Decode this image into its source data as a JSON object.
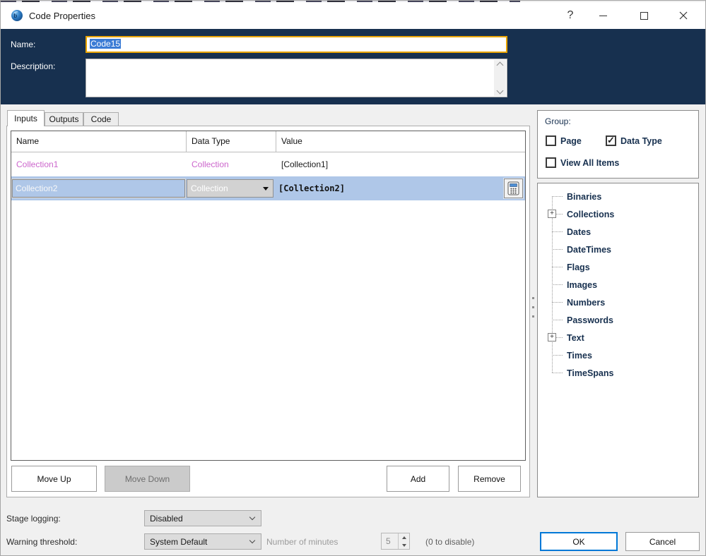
{
  "window": {
    "title": "Code Properties",
    "help_label": "?"
  },
  "header": {
    "name_label": "Name:",
    "name_value": "Code15",
    "description_label": "Description:",
    "description_value": ""
  },
  "tabs": [
    {
      "label": "Inputs",
      "active": true
    },
    {
      "label": "Outputs",
      "active": false
    },
    {
      "label": "Code",
      "active": false
    }
  ],
  "inputs_table": {
    "columns": [
      "Name",
      "Data Type",
      "Value"
    ],
    "rows": [
      {
        "name": "Collection1",
        "data_type": "Collection",
        "value": "[Collection1]",
        "selected": false
      },
      {
        "name": "Collection2",
        "data_type": "Collection",
        "value": "[Collection2]",
        "selected": true
      }
    ]
  },
  "list_buttons": {
    "move_up": "Move Up",
    "move_down": "Move Down",
    "add": "Add",
    "remove": "Remove"
  },
  "group_panel": {
    "title": "Group:",
    "options": [
      {
        "label": "Page",
        "checked": false
      },
      {
        "label": "Data Type",
        "checked": true
      },
      {
        "label": "View All Items",
        "checked": false
      }
    ]
  },
  "data_type_tree": {
    "items": [
      {
        "label": "Binaries",
        "expandable": false
      },
      {
        "label": "Collections",
        "expandable": true
      },
      {
        "label": "Dates",
        "expandable": false
      },
      {
        "label": "DateTimes",
        "expandable": false
      },
      {
        "label": "Flags",
        "expandable": false
      },
      {
        "label": "Images",
        "expandable": false
      },
      {
        "label": "Numbers",
        "expandable": false
      },
      {
        "label": "Passwords",
        "expandable": false
      },
      {
        "label": "Text",
        "expandable": true
      },
      {
        "label": "Times",
        "expandable": false
      },
      {
        "label": "TimeSpans",
        "expandable": false
      }
    ]
  },
  "footer": {
    "stage_logging_label": "Stage logging:",
    "stage_logging_value": "Disabled",
    "warning_threshold_label": "Warning threshold:",
    "warning_threshold_value": "System Default",
    "number_of_minutes_label": "Number of minutes",
    "minutes_value": "5",
    "disable_hint": "(0 to disable)",
    "ok_label": "OK",
    "cancel_label": "Cancel"
  },
  "colors": {
    "header_navy": "#17304F",
    "name_field_border_gold": "#E9A400",
    "collection_magenta": "#CC66CC",
    "selected_row_blue": "#AFC7E8",
    "selection_highlight": "#3A7BD5",
    "ok_focus_blue": "#0078D7"
  }
}
